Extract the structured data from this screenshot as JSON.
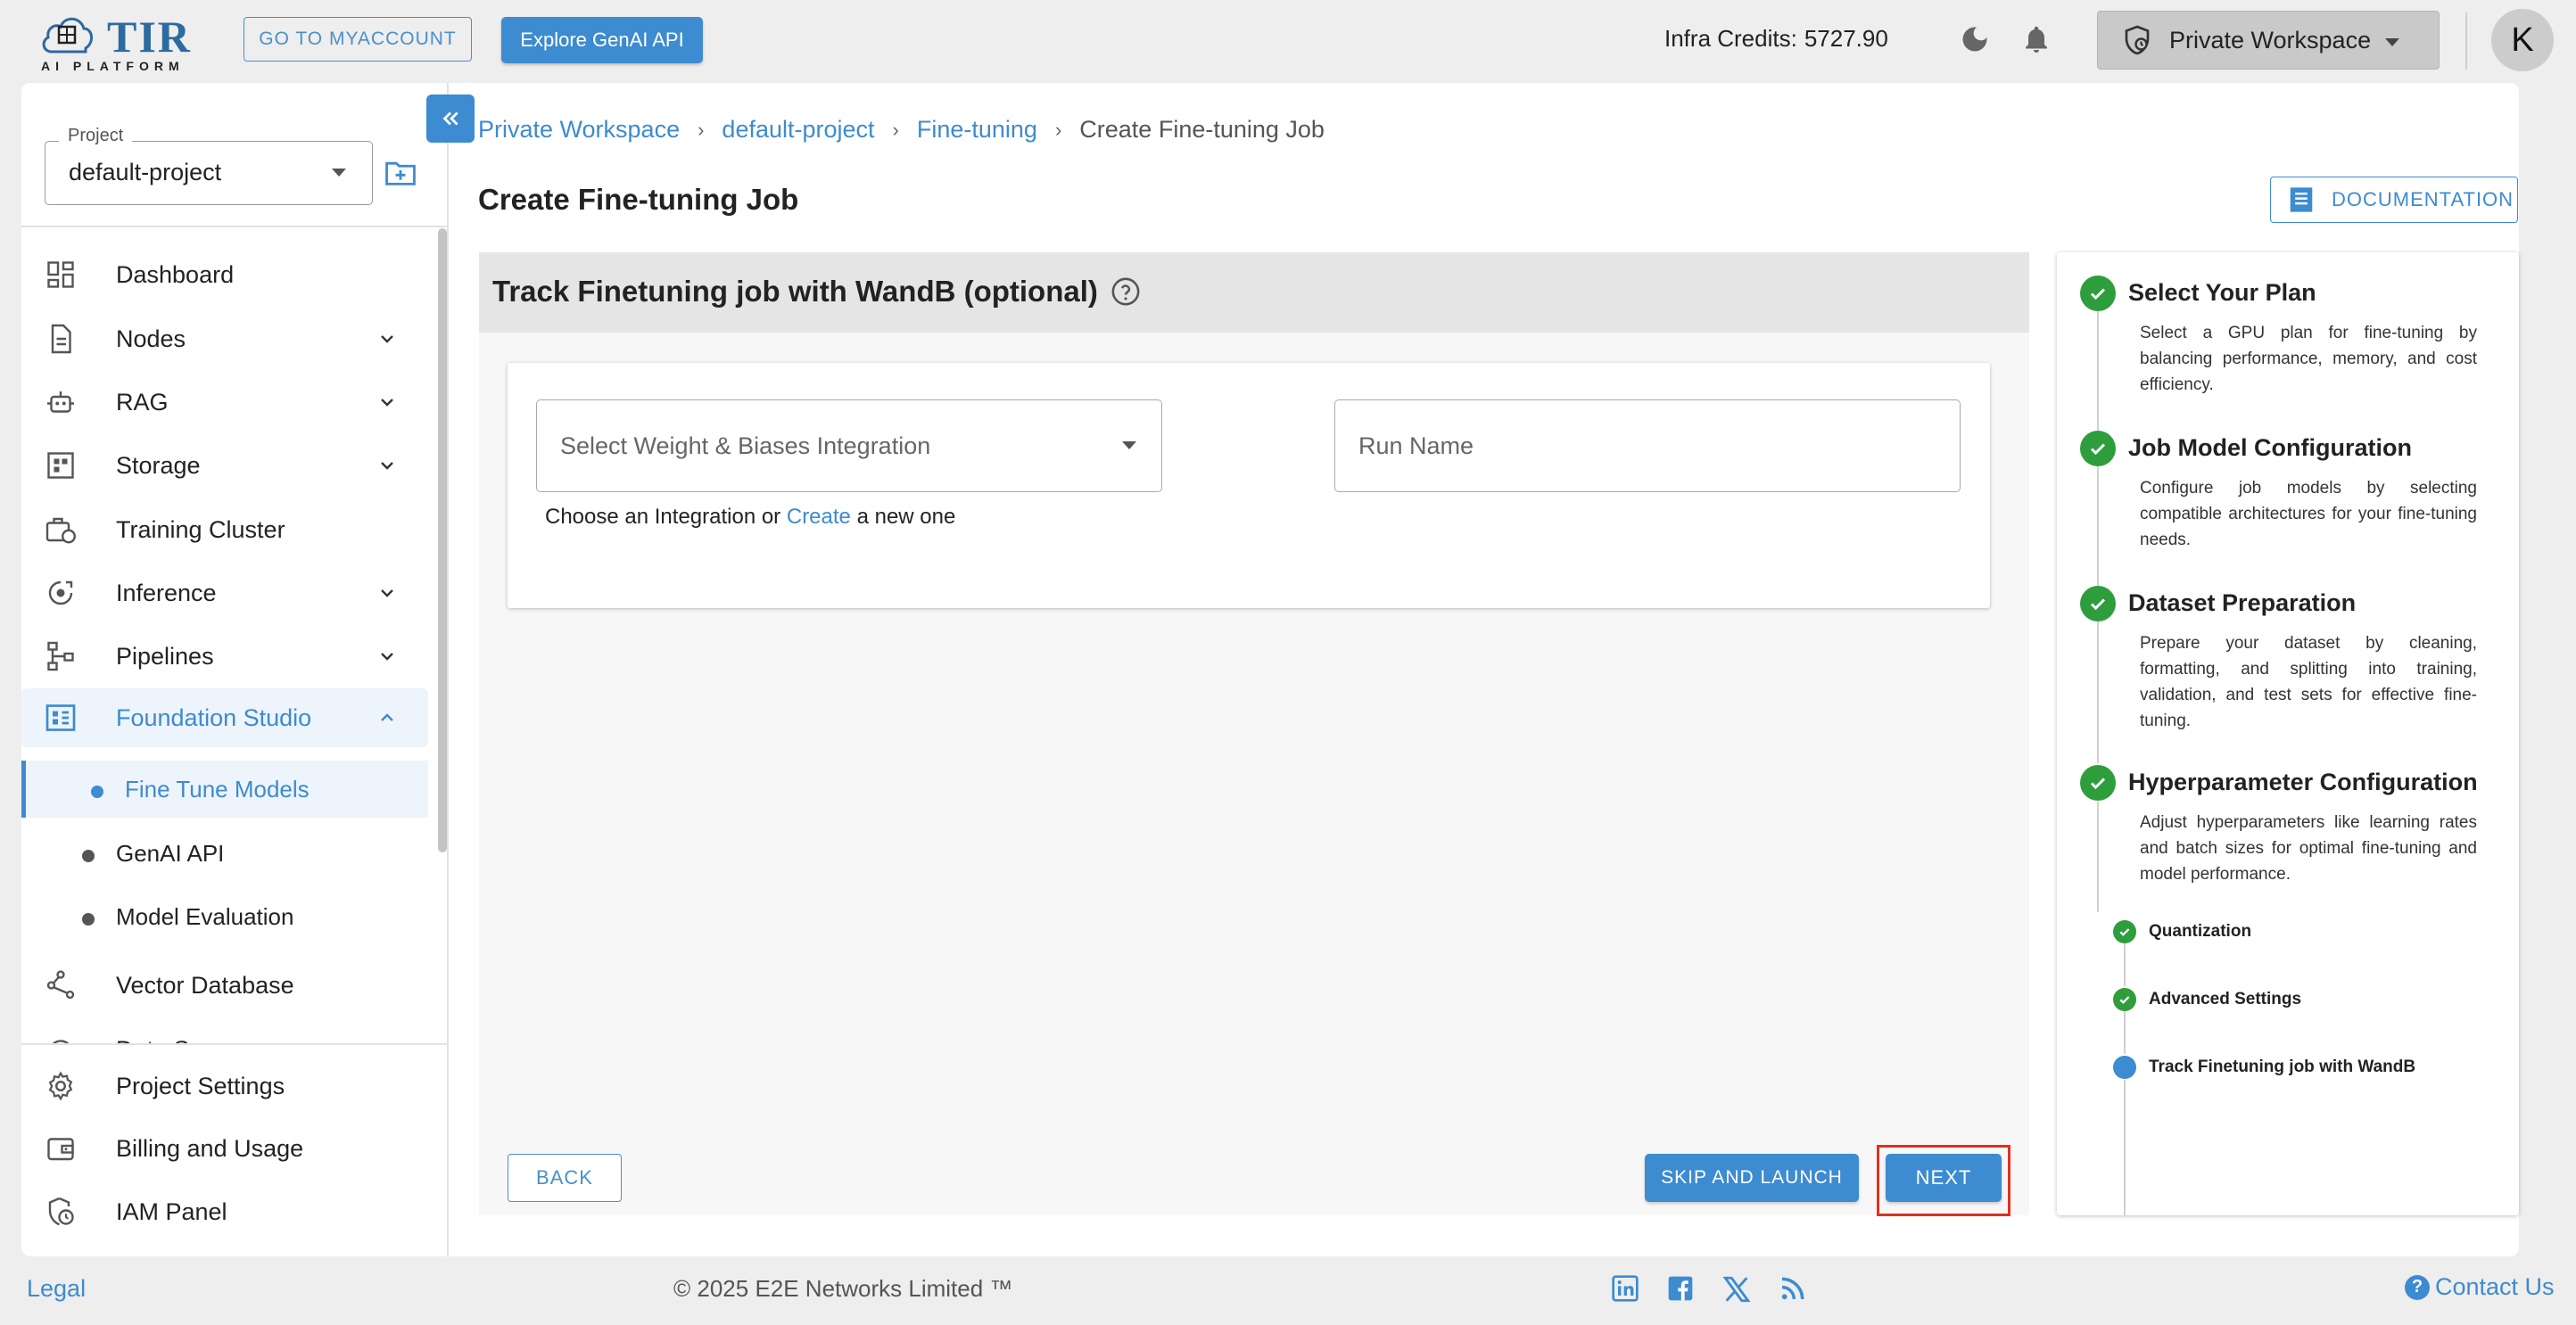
{
  "header": {
    "logo_text": "TIR",
    "logo_sub": "AI PLATFORM",
    "go_myaccount": "GO TO MYACCOUNT",
    "explore_genai": "Explore GenAI API",
    "credits_label": "Infra Credits:",
    "credits_value": "5727.90",
    "workspace": "Private Workspace",
    "avatar_initial": "K"
  },
  "sidebar": {
    "project_label": "Project",
    "project_value": "default-project",
    "items": [
      {
        "label": "Dashboard"
      },
      {
        "label": "Nodes"
      },
      {
        "label": "RAG"
      },
      {
        "label": "Storage"
      },
      {
        "label": "Training Cluster"
      },
      {
        "label": "Inference"
      },
      {
        "label": "Pipelines"
      },
      {
        "label": "Foundation Studio"
      }
    ],
    "sub_items": [
      {
        "label": "Fine Tune Models"
      },
      {
        "label": "GenAI API"
      },
      {
        "label": "Model Evaluation"
      }
    ],
    "vector_db": "Vector Database",
    "cut_item": "Data Syncer",
    "bottom_items": [
      {
        "label": "Project Settings"
      },
      {
        "label": "Billing and Usage"
      },
      {
        "label": "IAM Panel"
      }
    ]
  },
  "breadcrumb": {
    "b1": "Private Workspace",
    "b2": "default-project",
    "b3": "Fine-tuning",
    "current": "Create Fine-tuning Job"
  },
  "main": {
    "title": "Create Fine-tuning Job",
    "documentation": "DOCUMENTATION",
    "section_title": "Track Finetuning job with WandB (optional)",
    "select_placeholder": "Select Weight & Biases Integration",
    "run_name_placeholder": "Run Name",
    "helper_pre": "Choose an Integration or",
    "helper_link": "Create",
    "helper_post": "a new one",
    "back": "BACK",
    "skip": "SKIP AND LAUNCH",
    "next": "NEXT"
  },
  "stepper": {
    "steps": [
      {
        "title": "Select Your Plan",
        "desc": "Select a GPU plan for fine-tuning by balancing performance, memory, and cost efficiency."
      },
      {
        "title": "Job Model Configuration",
        "desc": "Configure job models by selecting compatible architectures for your fine-tuning needs."
      },
      {
        "title": "Dataset Preparation",
        "desc": "Prepare your dataset by cleaning, formatting, and splitting into training, validation, and test sets for effective fine-tuning."
      },
      {
        "title": "Hyperparameter Configuration",
        "desc": "Adjust hyperparameters like learning rates and batch sizes for optimal fine-tuning and model performance."
      }
    ],
    "sub_steps": [
      {
        "title": "Quantization"
      },
      {
        "title": "Advanced Settings"
      },
      {
        "title": "Track Finetuning job with WandB"
      }
    ]
  },
  "footer": {
    "legal": "Legal",
    "copyright": "© 2025 E2E Networks Limited ™",
    "contact": "Contact Us"
  },
  "colors": {
    "accent": "#3d8bd0",
    "success": "#2e9e3d",
    "highlight": "#e0301e"
  }
}
